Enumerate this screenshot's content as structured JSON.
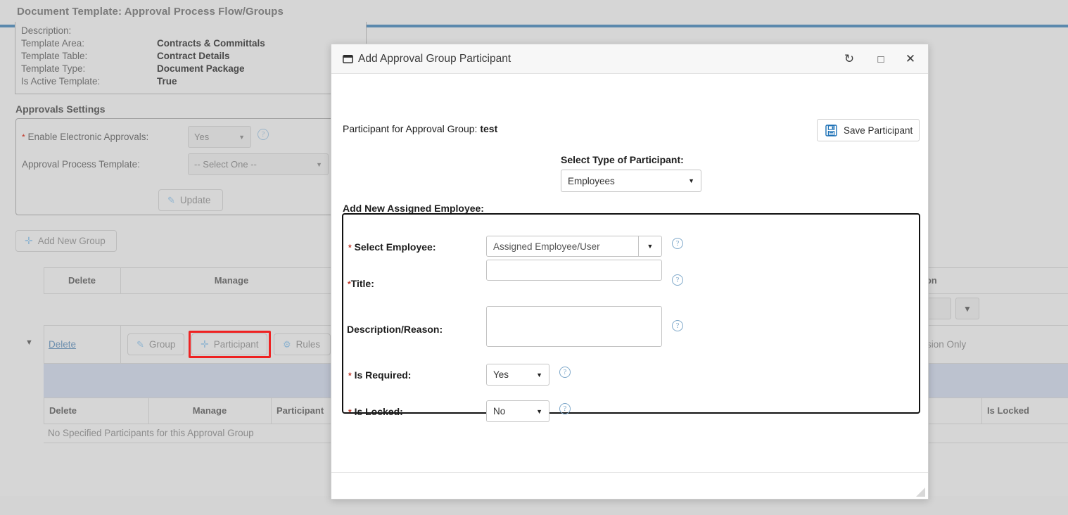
{
  "page": {
    "title": "Document Template: Approval Process Flow/Groups",
    "accent_color": "#5b89ad",
    "background_color": "#d6d6d6",
    "info": {
      "rows": [
        {
          "label": "Description:",
          "value": ""
        },
        {
          "label": "Template Area:",
          "value": "Contracts & Committals"
        },
        {
          "label": "Template Table:",
          "value": "Contract Details"
        },
        {
          "label": "Template Type:",
          "value": "Document Package"
        },
        {
          "label": "Is Active Template:",
          "value": "True"
        }
      ]
    },
    "approvals": {
      "heading": "Approvals Settings",
      "enable_label": "Enable Electronic Approvals:",
      "enable_value": "Yes",
      "template_label": "Approval Process Template:",
      "template_value": "-- Select One --",
      "update_label": "Update",
      "add_group_label": "Add New Group"
    },
    "groups_table": {
      "headers": [
        "Delete",
        "Manage"
      ],
      "right_header": "sion",
      "row": {
        "delete_label": "Delete",
        "manage_buttons": [
          "Group",
          "Participant",
          "Rules"
        ],
        "highlighted_button": "Participant",
        "version_text": "ersion Only"
      }
    },
    "participants_table": {
      "headers": [
        "Delete",
        "Manage",
        "Participant",
        "Is Locked"
      ],
      "empty_text": "No Specified Participants for this Approval Group"
    }
  },
  "modal": {
    "title": "Add Approval Group Participant",
    "window_icon": "window-icon",
    "titlebar_buttons": [
      {
        "name": "refresh-icon",
        "glyph": "↻"
      },
      {
        "name": "maximize-icon",
        "glyph": "□"
      },
      {
        "name": "close-icon",
        "glyph": "✕"
      }
    ],
    "participant_for_label": "Participant for Approval Group:",
    "participant_group_name": "test",
    "save_button_label": "Save Participant",
    "save_icon": "floppy-save-icon",
    "type_label": "Select Type of Participant:",
    "type_value": "Employees",
    "type_options": [
      "Employees"
    ],
    "fieldset_heading": "Add New Assigned Employee:",
    "fields": [
      {
        "name": "select-employee",
        "label": "Select Employee:",
        "required": true,
        "control": "combo",
        "value": "Assigned Employee/User",
        "help": true
      },
      {
        "name": "title",
        "label": "Title:",
        "required": true,
        "control": "text",
        "value": "",
        "help": true
      },
      {
        "name": "description-reason",
        "label": "Description/Reason:",
        "required": false,
        "control": "textarea",
        "value": "",
        "help": true
      },
      {
        "name": "is-required",
        "label": "Is Required:",
        "required": true,
        "control": "select",
        "value": "Yes",
        "help": true
      },
      {
        "name": "is-locked",
        "label": "Is Locked:",
        "required": true,
        "control": "select",
        "value": "No",
        "help": true
      }
    ]
  }
}
